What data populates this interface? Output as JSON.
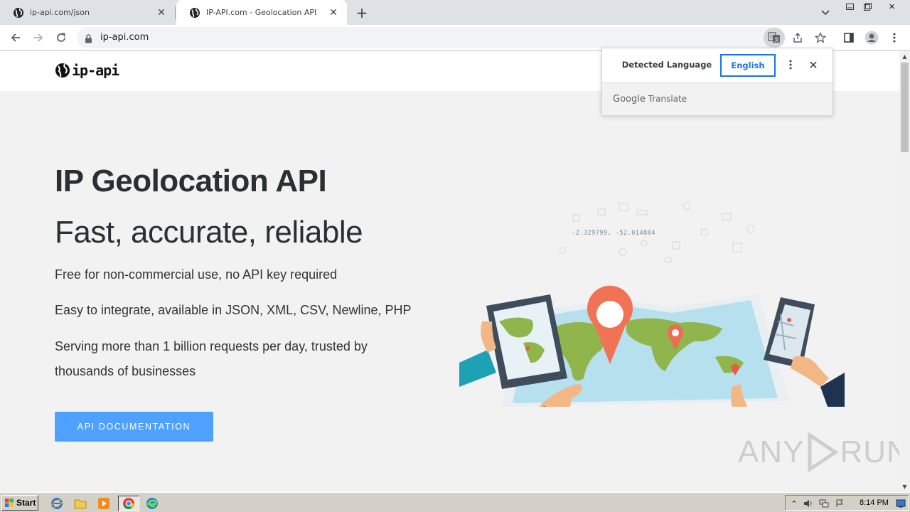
{
  "browser": {
    "tabs": [
      {
        "title": "ip-api.com/json",
        "active": false
      },
      {
        "title": "IP-API.com - Geolocation API",
        "active": true
      }
    ],
    "address": "ip-api.com"
  },
  "translate_bubble": {
    "source_language": "Detected Language",
    "target_language": "English",
    "brand_google": "Google",
    "brand_translate": "Translate"
  },
  "site": {
    "logo_text": "ip-api",
    "title": "IP Geolocation API",
    "subtitle": "Fast, accurate, reliable",
    "features": [
      "Free for non-commercial use, no API key required",
      "Easy to integrate, available in JSON, XML, CSV, Newline, PHP",
      "Serving more than 1 billion requests per day, trusted by thousands of businesses"
    ],
    "cta_label": "API DOCUMENTATION",
    "illustration_coordinates": "-2.329799, -52.014884",
    "accent_color": "#4ea1ff"
  },
  "watermark": {
    "left": "ANY",
    "right": "RUN"
  },
  "taskbar": {
    "start_label": "Start",
    "clock": "8:14 PM"
  }
}
